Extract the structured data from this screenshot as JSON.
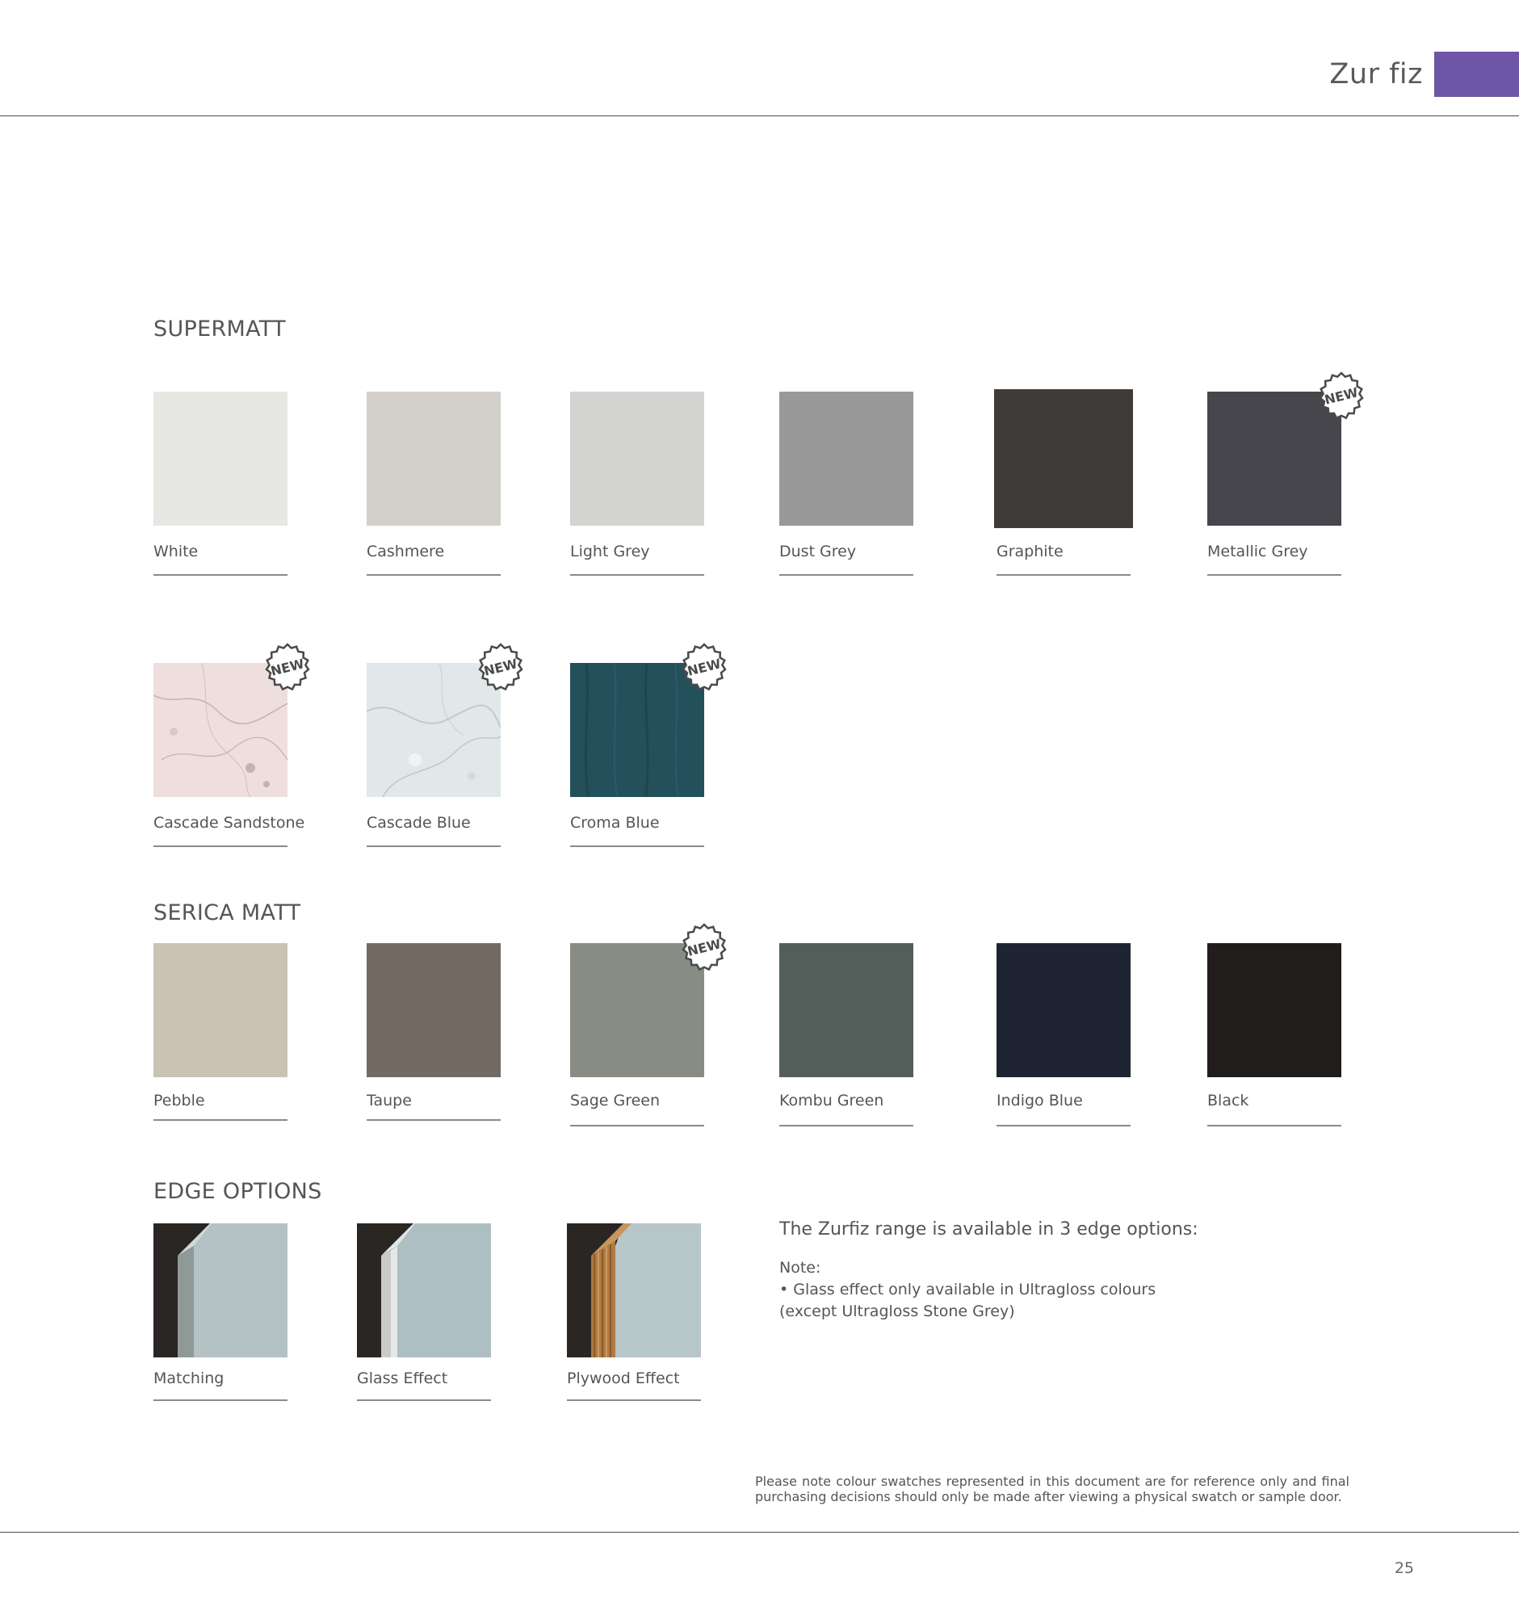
{
  "header": {
    "brand": "Zur fiz",
    "accent_color": "#6e55a5"
  },
  "sections": {
    "supermatt": {
      "title": "SUPERMATT"
    },
    "serica": {
      "title": "SERICA MATT"
    },
    "edge": {
      "title": "EDGE OPTIONS"
    }
  },
  "badge": {
    "text": "NEW"
  },
  "swatches": {
    "white": {
      "label": "White",
      "color": "#e7e7e3"
    },
    "cashmere": {
      "label": "Cashmere",
      "color": "#d3cfcb"
    },
    "light_grey": {
      "label": "Light Grey",
      "color": "#d3d3d1"
    },
    "dust_grey": {
      "label": "Dust Grey",
      "color": "#999999"
    },
    "graphite": {
      "label": "Graphite",
      "color": "#3e3a37"
    },
    "metallic_grey": {
      "label": "Metallic Grey",
      "color": "#46464c"
    },
    "cascade_sandstone": {
      "label": "Cascade Sandstone",
      "color": "#eedfdc"
    },
    "cascade_blue": {
      "label": "Cascade Blue",
      "color": "#e2e7e9"
    },
    "croma_blue": {
      "label": "Croma Blue",
      "color": "#23505b"
    },
    "pebble": {
      "label": "Pebble",
      "color": "#cac3b5"
    },
    "taupe": {
      "label": "Taupe",
      "color": "#736963"
    },
    "sage_green": {
      "label": "Sage Green",
      "color": "#878d85"
    },
    "kombu_green": {
      "label": "Kombu Green",
      "color": "#525e59"
    },
    "indigo_blue": {
      "label": "Indigo Blue",
      "color": "#1f2432"
    },
    "black": {
      "label": "Black",
      "color": "#211d1c"
    },
    "matching": {
      "label": "Matching"
    },
    "glass_effect": {
      "label": "Glass Effect"
    },
    "plywood_effect": {
      "label": "Plywood Effect"
    }
  },
  "edge_info": {
    "lead": "The Zurfiz range is available in 3 edge options:",
    "note_title": "Note:",
    "note_line1": "• Glass effect only available in Ultragloss colours",
    "note_line2": "(except Ultragloss Stone Grey)"
  },
  "footer": {
    "disclaimer": "Please note colour swatches represented in this document are for reference only and final purchasing decisions should only be made after viewing a physical swatch or sample door.",
    "page_number": "25"
  }
}
